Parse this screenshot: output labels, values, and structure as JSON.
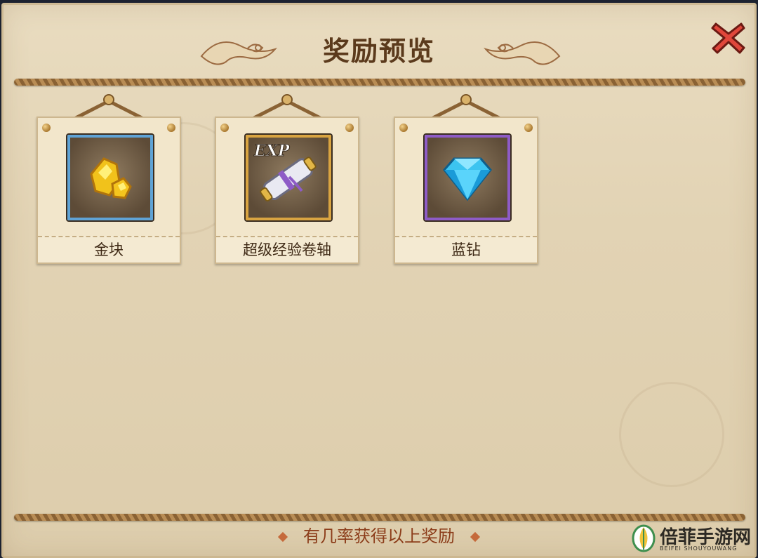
{
  "dialog": {
    "title": "奖励预览",
    "footer": "有几率获得以上奖励"
  },
  "rewards": [
    {
      "label": "金块",
      "icon": "gold-nugget-icon",
      "frame_color": "#5fa3d6"
    },
    {
      "label": "超级经验卷轴",
      "icon": "exp-scroll-icon",
      "frame_color": "#d9a441",
      "badge": "EXP"
    },
    {
      "label": "蓝钻",
      "icon": "blue-diamond-icon",
      "frame_color": "#8e5bc7"
    }
  ],
  "watermark": {
    "name": "倍菲手游网",
    "sub": "BEIFEI SHOUYOUWANG"
  }
}
